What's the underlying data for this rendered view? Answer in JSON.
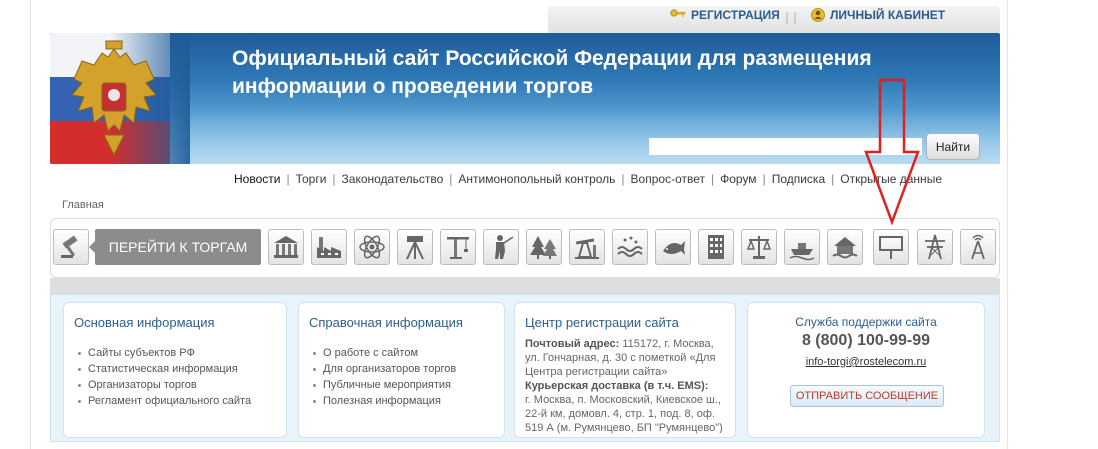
{
  "topbar": {
    "registration": "РЕГИСТРАЦИЯ",
    "cabinet": "ЛИЧНЫЙ КАБИНЕТ"
  },
  "header": {
    "title_line1": "Официальный сайт Российской Федерации для размещения",
    "title_line2": "информации о проведении торгов",
    "search_value": "",
    "search_button": "Найти"
  },
  "nav": {
    "items": [
      "Новости",
      "Торги",
      "Законодательство",
      "Антимонопольный контроль",
      "Вопрос-ответ",
      "Форум",
      "Подписка",
      "Открытые данные"
    ]
  },
  "breadcrumb": "Главная",
  "icon_bar": {
    "go_trading": "ПЕРЕЙТИ К ТОРГАМ",
    "icons": [
      "gavel-icon",
      "bank-building-icon",
      "factory-icon",
      "atom-icon",
      "surveying-icon",
      "crane-icon",
      "hunter-icon",
      "forest-icon",
      "oil-pump-icon",
      "water-icon",
      "fish-icon",
      "apartment-building-icon",
      "justice-scales-icon",
      "boat-icon",
      "house-flood-icon",
      "billboard-icon",
      "power-tower-icon",
      "radio-tower-icon"
    ]
  },
  "cards": {
    "main_info": {
      "title": "Основная информация",
      "items": [
        "Сайты субъектов РФ",
        "Статистическая информация",
        "Организаторы торгов",
        "Регламент официального сайта"
      ]
    },
    "reference": {
      "title": "Справочная информация",
      "items": [
        "О работе с сайтом",
        "Для организаторов торгов",
        "Публичные мероприятия",
        "Полезная информация"
      ]
    },
    "registration_center": {
      "title": "Центр регистрации сайта",
      "postal_label": "Почтовый адрес:",
      "postal_text": "115172, г. Москва, ул. Гончарная, д. 30 с пометкой «Для Центра регистрации сайта»",
      "courier_label": "Курьерская доставка (в т.ч. EMS):",
      "courier_text": "г. Москва, п. Московский, Киевское ш., 22-й км, домовл. 4, стр. 1, под. 8, оф. 519 А (м. Румянцево, БП \"Румянцево\")"
    },
    "support": {
      "title": "Служба поддержки сайта",
      "phone": "8 (800) 100-99-99",
      "email": "info-torgi@rostelecom.ru",
      "button": "ОТПРАВИТЬ СООБЩЕНИЕ"
    }
  },
  "colors": {
    "banner_blue": "#2f78b6",
    "link_blue": "#2a5d8f",
    "info_bg": "#e8f4fa",
    "arrow_red": "#e0201c"
  }
}
